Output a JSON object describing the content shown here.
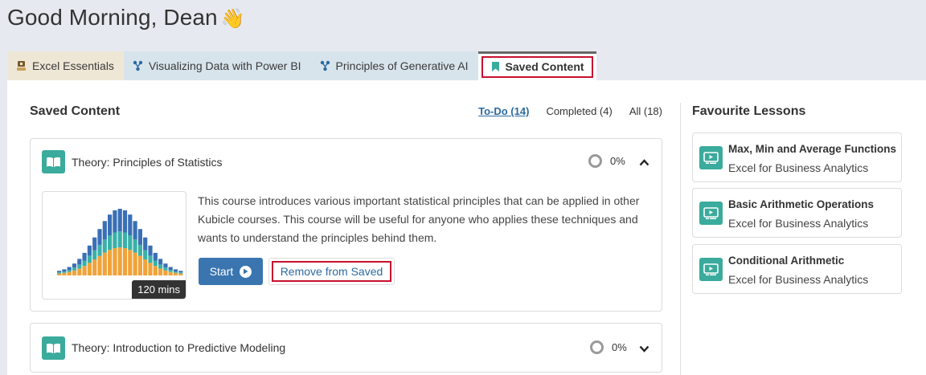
{
  "greeting": {
    "text": "Good Morning, Dean",
    "emoji": "👋"
  },
  "tabs": [
    {
      "label": "Excel Essentials",
      "icon": "graduation-icon"
    },
    {
      "label": "Visualizing Data with Power BI",
      "icon": "network-icon"
    },
    {
      "label": "Principles of Generative AI",
      "icon": "network-icon"
    },
    {
      "label": "Saved Content",
      "icon": "bookmark-icon",
      "active": true
    }
  ],
  "saved": {
    "title": "Saved Content",
    "filters": [
      {
        "label": "To-Do (14)",
        "active": true
      },
      {
        "label": "Completed (4)",
        "active": false
      },
      {
        "label": "All (18)",
        "active": false
      }
    ],
    "items": [
      {
        "title": "Theory: Principles of Statistics",
        "progress": "0%",
        "expanded": true,
        "description": "This course introduces various important statistical principles that can be applied in other Kubicle courses. This course will be useful for anyone who applies these techniques and wants to understand the principles behind them.",
        "duration": "120 mins",
        "start_label": "Start",
        "remove_label": "Remove from Saved"
      },
      {
        "title": "Theory: Introduction to Predictive Modeling",
        "progress": "0%",
        "expanded": false
      }
    ]
  },
  "favourites": {
    "title": "Favourite Lessons",
    "items": [
      {
        "name": "Max, Min and Average Functions",
        "course": "Excel for Business Analytics"
      },
      {
        "name": "Basic Arithmetic Operations",
        "course": "Excel for Business Analytics"
      },
      {
        "name": "Conditional Arithmetic",
        "course": "Excel for Business Analytics"
      }
    ]
  },
  "colors": {
    "accent": "#3aab9c",
    "primary": "#3a75b0",
    "highlight": "#c8102e"
  }
}
